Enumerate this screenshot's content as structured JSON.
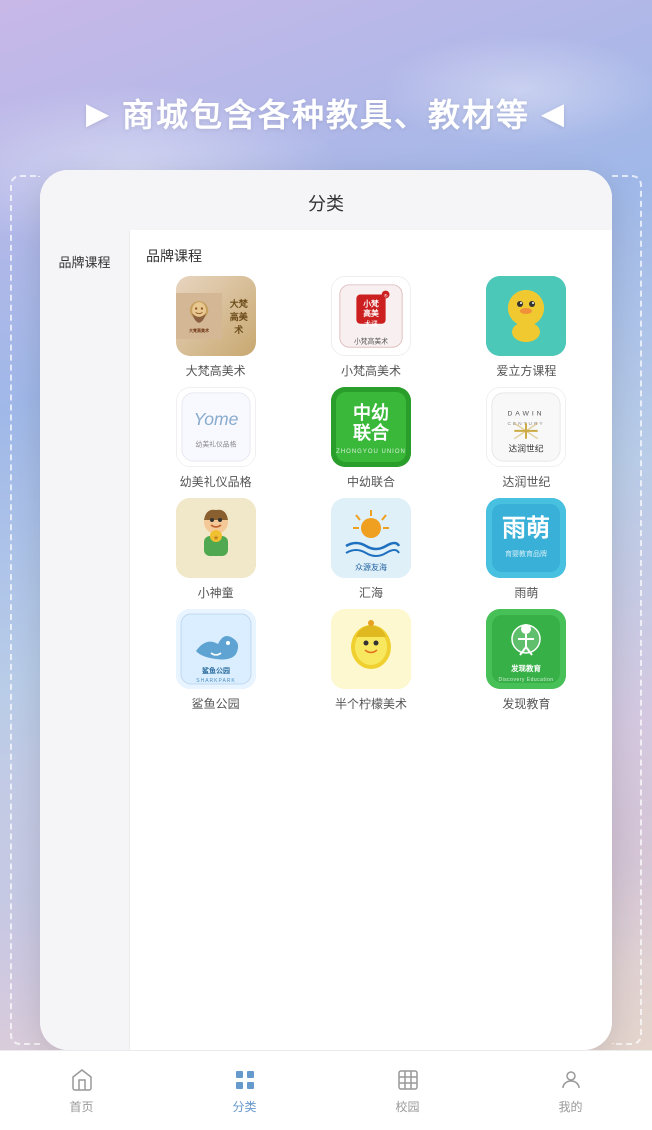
{
  "header": {
    "arrow_left": "▶",
    "arrow_right": "◀",
    "title": "商城包含各种教具、教材等"
  },
  "card": {
    "title": "分类",
    "sidebar_items": [
      {
        "label": "品牌课程",
        "active": true
      }
    ],
    "section_label": "品牌课程",
    "brands": [
      {
        "name": "大梵高美术",
        "color1": "#e8d0a8",
        "color2": "#c89050"
      },
      {
        "name": "小梵高美术",
        "color1": "#fff0f0",
        "color2": "#ffe0e0"
      },
      {
        "name": "爱立方课程",
        "color1": "#4cc8c0",
        "color2": "#2aacac"
      },
      {
        "name": "幼美礼仪品格",
        "color1": "#f8f8f8",
        "color2": "#eeeeee"
      },
      {
        "name": "中幼联合",
        "color1": "#2a9e2a",
        "color2": "#1a8e1a"
      },
      {
        "name": "达润世纪",
        "color1": "#f8f8f8",
        "color2": "#eeeeee"
      },
      {
        "name": "小神童",
        "color1": "#f5e8c0",
        "color2": "#e8d090"
      },
      {
        "name": "汇海",
        "color1": "#d8ecf8",
        "color2": "#b8d8f0"
      },
      {
        "name": "雨萌",
        "color1": "#50c0e8",
        "color2": "#30a8d8"
      },
      {
        "name": "鲨鱼公园",
        "color1": "#d8eef8",
        "color2": "#b8d8f0"
      },
      {
        "name": "半个柠檬美术",
        "color1": "#fdf8c8",
        "color2": "#f0e050"
      },
      {
        "name": "发现教育",
        "color1": "#50c858",
        "color2": "#38b040"
      }
    ]
  },
  "bottom_nav": {
    "items": [
      {
        "id": "home",
        "label": "首页",
        "active": false
      },
      {
        "id": "category",
        "label": "分类",
        "active": true
      },
      {
        "id": "campus",
        "label": "校园",
        "active": false
      },
      {
        "id": "mine",
        "label": "我的",
        "active": false
      }
    ]
  }
}
